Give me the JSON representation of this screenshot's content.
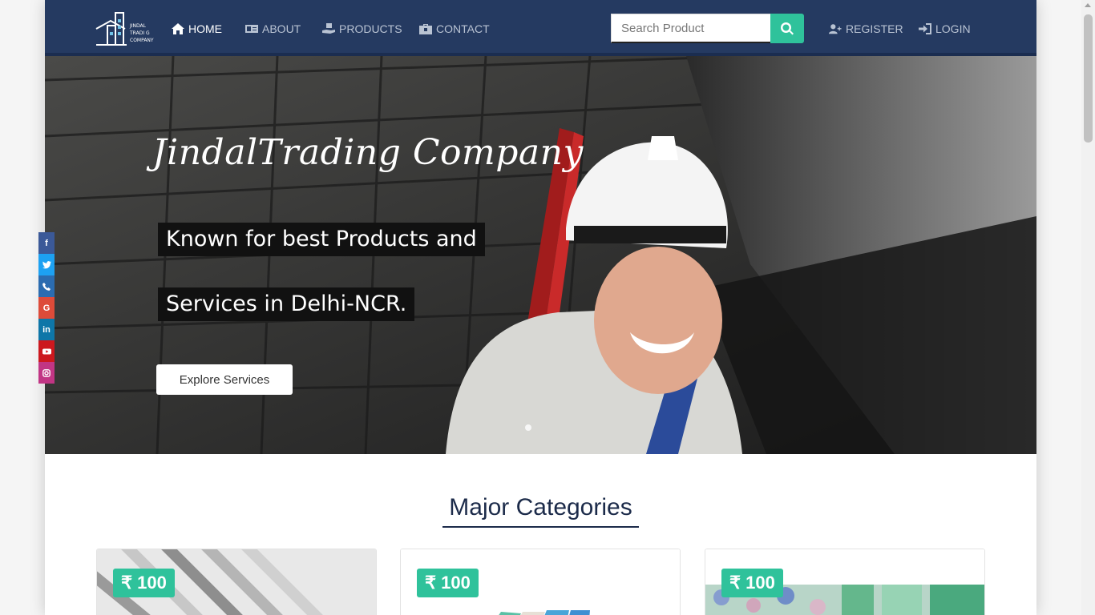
{
  "nav": {
    "items": [
      {
        "label": "HOME",
        "icon": "home-icon"
      },
      {
        "label": "ABOUT",
        "icon": "id-card-icon"
      },
      {
        "label": "PRODUCTS",
        "icon": "hand-box-icon"
      },
      {
        "label": "CONTACT",
        "icon": "briefcase-icon"
      }
    ],
    "search_placeholder": "Search Product",
    "register_label": "REGISTER",
    "login_label": "LOGIN",
    "logo_text": [
      "JINDAL",
      "TRADI G",
      "COMPANY"
    ]
  },
  "hero": {
    "title": "JindalTrading Company",
    "line1": "Known for best Products and",
    "line2": "Services in Delhi-NCR.",
    "button_label": "Explore Services"
  },
  "social": [
    "facebook-icon",
    "twitter-icon",
    "phone-icon",
    "google-icon",
    "linkedin-icon",
    "youtube-icon",
    "instagram-icon"
  ],
  "categories": {
    "title": "Major Categories",
    "cards": [
      {
        "price": "₹ 100"
      },
      {
        "price": "₹ 100"
      },
      {
        "price": "₹ 100"
      }
    ]
  },
  "colors": {
    "navbar": "#253a61",
    "accent": "#2fc29b",
    "heading": "#1c2b4a"
  }
}
